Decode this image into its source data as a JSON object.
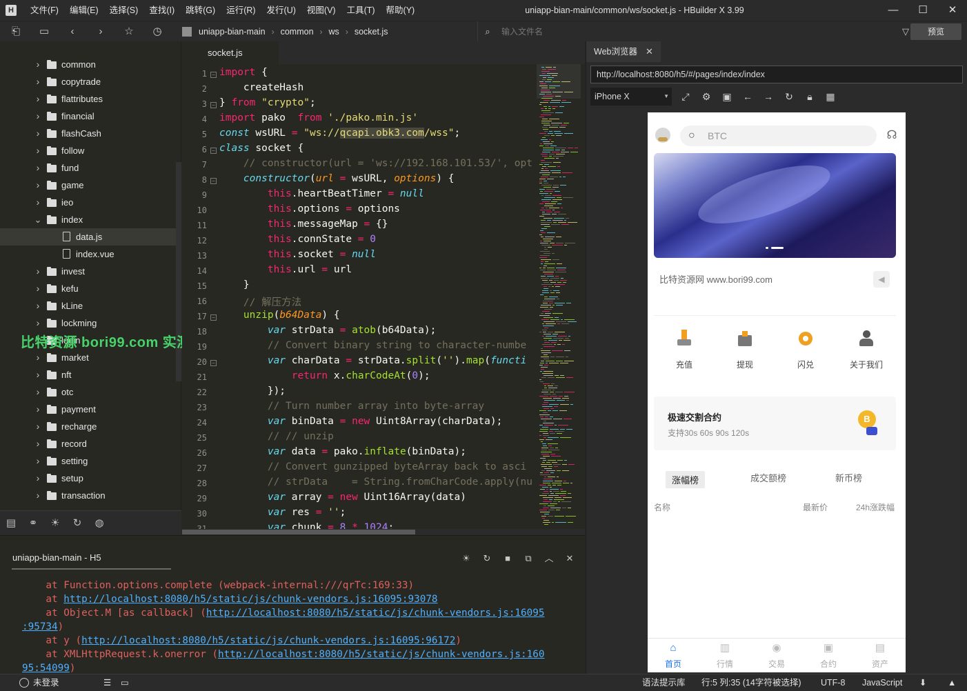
{
  "app": {
    "logo": "H",
    "title": "uniapp-bian-main/common/ws/socket.js - HBuilder X 3.99"
  },
  "menu": [
    "文件(F)",
    "编辑(E)",
    "选择(S)",
    "查找(I)",
    "跳转(G)",
    "运行(R)",
    "发行(U)",
    "视图(V)",
    "工具(T)",
    "帮助(Y)"
  ],
  "window_controls": {
    "minimize": "—",
    "maximize": "☐",
    "close": "✕"
  },
  "breadcrumb": [
    "uniapp-bian-main",
    "common",
    "ws",
    "socket.js"
  ],
  "file_search": {
    "placeholder": "输入文件名"
  },
  "toolbar": {
    "preview_label": "预览"
  },
  "sidebar": {
    "items": [
      {
        "label": "common",
        "type": "folder",
        "open": false
      },
      {
        "label": "copytrade",
        "type": "folder",
        "open": false
      },
      {
        "label": "flattributes",
        "type": "folder",
        "open": false
      },
      {
        "label": "financial",
        "type": "folder",
        "open": false
      },
      {
        "label": "flashCash",
        "type": "folder",
        "open": false
      },
      {
        "label": "follow",
        "type": "folder",
        "open": false
      },
      {
        "label": "fund",
        "type": "folder",
        "open": false
      },
      {
        "label": "game",
        "type": "folder",
        "open": false
      },
      {
        "label": "ieo",
        "type": "folder",
        "open": false
      },
      {
        "label": "index",
        "type": "folder",
        "open": true
      },
      {
        "label": "data.js",
        "type": "file",
        "selected": true
      },
      {
        "label": "index.vue",
        "type": "file"
      },
      {
        "label": "invest",
        "type": "folder",
        "open": false
      },
      {
        "label": "kefu",
        "type": "folder",
        "open": false
      },
      {
        "label": "kLine",
        "type": "folder",
        "open": false
      },
      {
        "label": "lockming",
        "type": "folder",
        "open": false
      },
      {
        "label": "login",
        "type": "folder",
        "open": false
      },
      {
        "label": "market",
        "type": "folder",
        "open": false
      },
      {
        "label": "nft",
        "type": "folder",
        "open": false
      },
      {
        "label": "otc",
        "type": "folder",
        "open": false
      },
      {
        "label": "payment",
        "type": "folder",
        "open": false
      },
      {
        "label": "recharge",
        "type": "folder",
        "open": false
      },
      {
        "label": "record",
        "type": "folder",
        "open": false
      },
      {
        "label": "setting",
        "type": "folder",
        "open": false
      },
      {
        "label": "setup",
        "type": "folder",
        "open": false
      },
      {
        "label": "transaction",
        "type": "folder",
        "open": false
      }
    ],
    "watermark": "比特资源 bori99.com 实测分享"
  },
  "editor": {
    "tab": "socket.js",
    "lines": [
      {
        "n": "1",
        "fold": "−",
        "html": "<span class='kw'>import</span> {"
      },
      {
        "n": "2",
        "html": "    createHash"
      },
      {
        "n": "3",
        "fold": "−",
        "html": "} <span class='kw'>from</span> <span class='st'>\"crypto\"</span>;"
      },
      {
        "n": "4",
        "html": "<span class='kw'>import</span> pako  <span class='kw'>from</span> <span class='st'>'./pako.min.js'</span>"
      },
      {
        "n": "5",
        "html": "<span class='it'>const</span> wsURL <span class='kw'>=</span> <span class='st'>\"ws://<span class='hl'>qcapi.obk3.com</span>/wss\"</span>;"
      },
      {
        "n": "6",
        "fold": "−",
        "html": "<span class='it'>class</span> socket {"
      },
      {
        "n": "7",
        "html": "    <span class='cm'>// constructor(url = 'ws://192.168.101.53/', opt</span>"
      },
      {
        "n": "8",
        "fold": "−",
        "html": "    <span class='it'>constructor</span>(<span class='pa'>url</span> <span class='kw'>=</span> wsURL, <span class='pa'>options</span>) {"
      },
      {
        "n": "9",
        "html": "        <span class='th'>this</span>.heartBeatTimer <span class='kw'>=</span> <span class='it'>null</span>"
      },
      {
        "n": "10",
        "html": "        <span class='th'>this</span>.options <span class='kw'>=</span> options"
      },
      {
        "n": "11",
        "html": "        <span class='th'>this</span>.messageMap <span class='kw'>=</span> {}"
      },
      {
        "n": "12",
        "html": "        <span class='th'>this</span>.connState <span class='kw'>=</span> <span class='nm'>0</span>"
      },
      {
        "n": "13",
        "html": "        <span class='th'>this</span>.socket <span class='kw'>=</span> <span class='it'>null</span>"
      },
      {
        "n": "14",
        "html": "        <span class='th'>this</span>.url <span class='kw'>=</span> url"
      },
      {
        "n": "15",
        "html": "    }"
      },
      {
        "n": "16",
        "html": "    <span class='cm'>// 解压方法</span>"
      },
      {
        "n": "17",
        "fold": "−",
        "html": "    <span class='fn'>unzip</span>(<span class='pa'>b64Data</span>) {"
      },
      {
        "n": "18",
        "html": "        <span class='it'>var</span> strData <span class='kw'>=</span> <span class='fn'>atob</span>(b64Data);"
      },
      {
        "n": "19",
        "html": "        <span class='cm'>// Convert binary string to character-numbe</span>"
      },
      {
        "n": "20",
        "fold": "−",
        "html": "        <span class='it'>var</span> charData <span class='kw'>=</span> strData.<span class='fn'>split</span>(<span class='st'>''</span>).<span class='fn'>map</span>(<span class='it'>functi</span>"
      },
      {
        "n": "21",
        "html": "            <span class='kw'>return</span> x.<span class='fn'>charCodeAt</span>(<span class='nm'>0</span>);"
      },
      {
        "n": "22",
        "html": "        });"
      },
      {
        "n": "23",
        "html": "        <span class='cm'>// Turn number array into byte-array</span>"
      },
      {
        "n": "24",
        "html": "        <span class='it'>var</span> binData <span class='kw'>=</span> <span class='kw'>new</span> Uint8Array(charData);"
      },
      {
        "n": "25",
        "html": "        <span class='cm'>// // unzip</span>"
      },
      {
        "n": "26",
        "html": "        <span class='it'>var</span> data <span class='kw'>=</span> pako.<span class='fn'>inflate</span>(binData);"
      },
      {
        "n": "27",
        "html": "        <span class='cm'>// Convert gunzipped byteArray back to asci</span>"
      },
      {
        "n": "28",
        "html": "        <span class='cm'>// strData    = String.fromCharCode.apply(nu</span>"
      },
      {
        "n": "29",
        "html": "        <span class='it'>var</span> array <span class='kw'>=</span> <span class='kw'>new</span> Uint16Array(data)"
      },
      {
        "n": "30",
        "html": "        <span class='it'>var</span> res <span class='kw'>=</span> <span class='st'>''</span>;"
      },
      {
        "n": "31",
        "html": "        <span class='it'>var</span> chunk <span class='kw'>=</span> <span class='nm'>8</span> <span class='kw'>*</span> <span class='nm'>1024</span>;"
      }
    ]
  },
  "browser": {
    "tab": "Web浏览器",
    "tab_close": "✕",
    "url": "http://localhost:8080/h5/#/pages/index/index",
    "device": "iPhone X"
  },
  "phone": {
    "search_placeholder": "BTC",
    "notice": "比特资源网 www.bori99.com",
    "quick_actions": [
      "充值",
      "提现",
      "闪兑",
      "关于我们"
    ],
    "card": {
      "title": "极速交割合约",
      "subtitle": "支持30s 60s 90s 120s",
      "coin": "B"
    },
    "tabs": [
      "涨幅榜",
      "成交额榜",
      "新币榜"
    ],
    "columns": [
      "名称",
      "最新价",
      "24h涨跌幅"
    ],
    "nav": [
      {
        "label": "首页",
        "icon": "⌂",
        "active": true
      },
      {
        "label": "行情",
        "icon": "▥"
      },
      {
        "label": "交易",
        "icon": "◉"
      },
      {
        "label": "合约",
        "icon": "▣"
      },
      {
        "label": "资产",
        "icon": "▤"
      }
    ]
  },
  "console": {
    "tab": "uniapp-bian-main - H5",
    "lines": [
      {
        "html": "    at Function.options.complete (webpack-internal:///qrTc:169:33)"
      },
      {
        "html": "    at <a>http://localhost:8080/h5/static/js/chunk-vendors.js:16095:93078</a>"
      },
      {
        "html": "    at Object.M [as callback] (<a>http://localhost:8080/h5/static/js/chunk-vendors.js:16095</a>"
      },
      {
        "html": "<a>:95734</a>)",
        "indent": 0
      },
      {
        "html": "    at y (<a>http://localhost:8080/h5/static/js/chunk-vendors.js:16095:96172</a>)"
      },
      {
        "html": "    at XMLHttpRequest.k.onerror (<a>http://localhost:8080/h5/static/js/chunk-vendors.js:160</a>"
      },
      {
        "html": "<a>95:54099</a>)",
        "indent": 0
      }
    ]
  },
  "status": {
    "login": "未登录",
    "syntax_hint": "语法提示库",
    "position": "行:5  列:35 (14字符被选择)",
    "encoding": "UTF-8",
    "language": "JavaScript"
  }
}
